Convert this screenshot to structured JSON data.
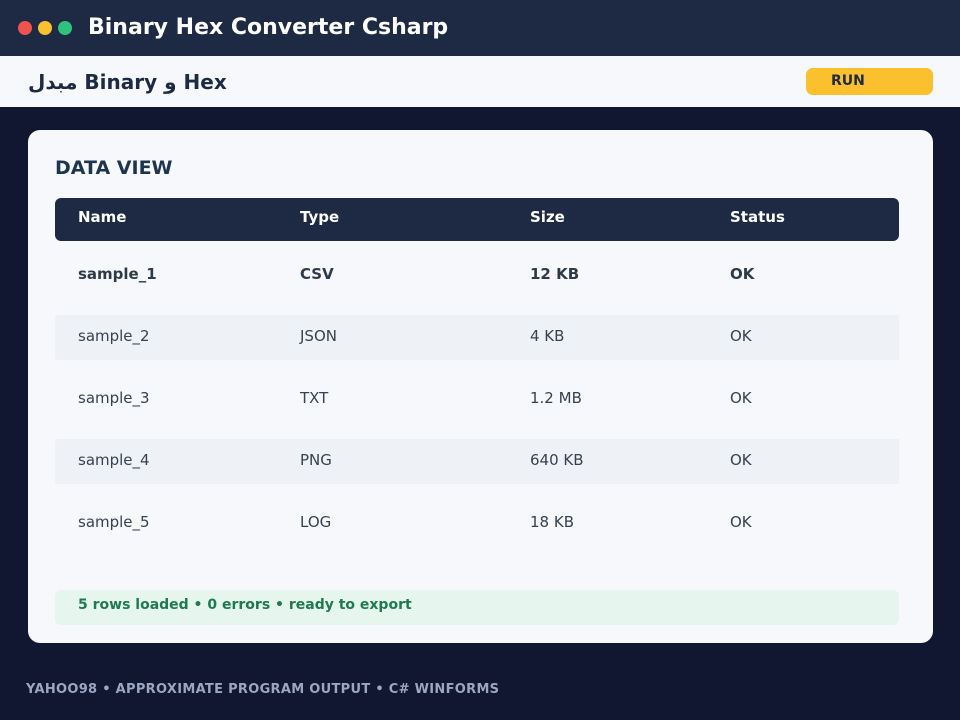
{
  "window": {
    "title": "Binary Hex Converter Csharp",
    "controls": [
      "close",
      "minimize",
      "maximize"
    ]
  },
  "header": {
    "title": "مبدل Binary و Hex",
    "run_label": "RUN"
  },
  "card": {
    "section_title": "DATA VIEW",
    "columns": [
      "Name",
      "Type",
      "Size",
      "Status"
    ],
    "rows": [
      [
        "sample_1",
        "CSV",
        "12 KB",
        "OK"
      ],
      [
        "sample_2",
        "JSON",
        "4 KB",
        "OK"
      ],
      [
        "sample_3",
        "TXT",
        "1.2 MB",
        "OK"
      ],
      [
        "sample_4",
        "PNG",
        "640 KB",
        "OK"
      ],
      [
        "sample_5",
        "LOG",
        "18 KB",
        "OK"
      ]
    ],
    "status": "5 rows loaded  •  0 errors  •  ready to export"
  },
  "footer": {
    "text": "YAHOO98  •  APPROXIMATE PROGRAM OUTPUT  •  C# WINFORMS"
  },
  "colors": {
    "titlebar": "#1e2a44",
    "accent": "#fbc02d",
    "background": "#111730",
    "status_text": "#1f7a4f"
  }
}
